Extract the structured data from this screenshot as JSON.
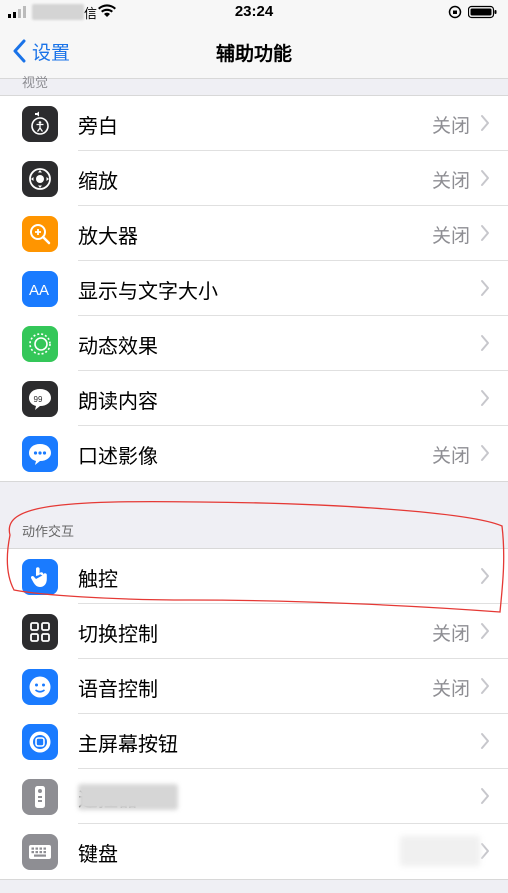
{
  "status_bar": {
    "carrier_suffix": "信",
    "time": "23:24"
  },
  "nav": {
    "back_label": "设置",
    "title": "辅助功能"
  },
  "sections": {
    "vision_header_partial": "视觉",
    "interaction_header": "动作交互"
  },
  "vision_rows": [
    {
      "label": "旁白",
      "value": "关闭",
      "icon": "voiceover-icon",
      "color": "#2c2c2e"
    },
    {
      "label": "缩放",
      "value": "关闭",
      "icon": "zoom-icon",
      "color": "#2c2c2e"
    },
    {
      "label": "放大器",
      "value": "关闭",
      "icon": "magnifier-icon",
      "color": "#ff9500"
    },
    {
      "label": "显示与文字大小",
      "value": "",
      "icon": "text-size-icon",
      "color": "#1a7bff"
    },
    {
      "label": "动态效果",
      "value": "",
      "icon": "motion-icon",
      "color": "#34c759"
    },
    {
      "label": "朗读内容",
      "value": "",
      "icon": "spoken-content-icon",
      "color": "#2c2c2e"
    },
    {
      "label": "口述影像",
      "value": "关闭",
      "icon": "audio-description-icon",
      "color": "#1a7bff"
    }
  ],
  "interaction_rows": [
    {
      "label": "触控",
      "value": "",
      "icon": "touch-icon",
      "color": "#1a7bff"
    },
    {
      "label": "切换控制",
      "value": "关闭",
      "icon": "switch-control-icon",
      "color": "#2c2c2e"
    },
    {
      "label": "语音控制",
      "value": "关闭",
      "icon": "voice-control-icon",
      "color": "#1a7bff"
    },
    {
      "label": "主屏幕按钮",
      "value": "",
      "icon": "home-button-icon",
      "color": "#1a7bff"
    },
    {
      "label": "遥控器",
      "value": "",
      "icon": "remote-icon",
      "color": "#8e8e93"
    },
    {
      "label": "键盘",
      "value": "",
      "icon": "keyboard-icon",
      "color": "#8e8e93"
    }
  ],
  "colors": {
    "accent": "#1a73e8",
    "annotation": "#e53935"
  }
}
